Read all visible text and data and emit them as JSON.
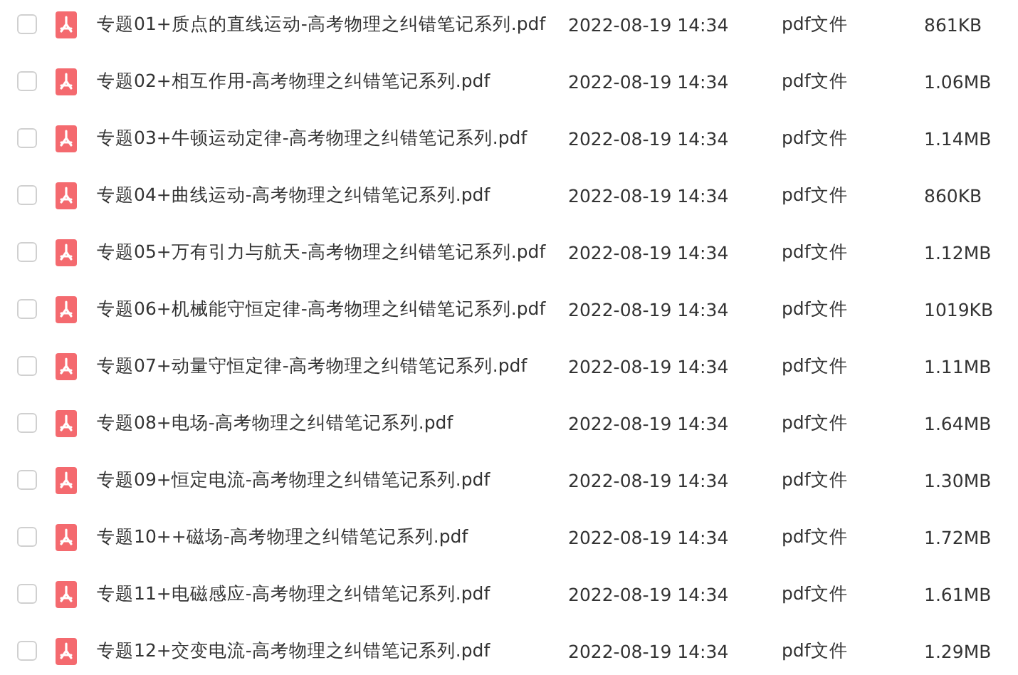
{
  "files": [
    {
      "name": "专题01+质点的直线运动-高考物理之纠错笔记系列.pdf",
      "date": "2022-08-19 14:34",
      "type": "pdf文件",
      "size": "861KB",
      "checked": false
    },
    {
      "name": "专题02+相互作用-高考物理之纠错笔记系列.pdf",
      "date": "2022-08-19 14:34",
      "type": "pdf文件",
      "size": "1.06MB",
      "checked": false
    },
    {
      "name": "专题03+牛顿运动定律-高考物理之纠错笔记系列.pdf",
      "date": "2022-08-19 14:34",
      "type": "pdf文件",
      "size": "1.14MB",
      "checked": false
    },
    {
      "name": "专题04+曲线运动-高考物理之纠错笔记系列.pdf",
      "date": "2022-08-19 14:34",
      "type": "pdf文件",
      "size": "860KB",
      "checked": false
    },
    {
      "name": "专题05+万有引力与航天-高考物理之纠错笔记系列.pdf",
      "date": "2022-08-19 14:34",
      "type": "pdf文件",
      "size": "1.12MB",
      "checked": false
    },
    {
      "name": "专题06+机械能守恒定律-高考物理之纠错笔记系列.pdf",
      "date": "2022-08-19 14:34",
      "type": "pdf文件",
      "size": "1019KB",
      "checked": false
    },
    {
      "name": "专题07+动量守恒定律-高考物理之纠错笔记系列.pdf",
      "date": "2022-08-19 14:34",
      "type": "pdf文件",
      "size": "1.11MB",
      "checked": false
    },
    {
      "name": "专题08+电场-高考物理之纠错笔记系列.pdf",
      "date": "2022-08-19 14:34",
      "type": "pdf文件",
      "size": "1.64MB",
      "checked": false
    },
    {
      "name": "专题09+恒定电流-高考物理之纠错笔记系列.pdf",
      "date": "2022-08-19 14:34",
      "type": "pdf文件",
      "size": "1.30MB",
      "checked": false
    },
    {
      "name": "专题10++磁场-高考物理之纠错笔记系列.pdf",
      "date": "2022-08-19 14:34",
      "type": "pdf文件",
      "size": "1.72MB",
      "checked": false
    },
    {
      "name": "专题11+电磁感应-高考物理之纠错笔记系列.pdf",
      "date": "2022-08-19 14:34",
      "type": "pdf文件",
      "size": "1.61MB",
      "checked": false
    },
    {
      "name": "专题12+交变电流-高考物理之纠错笔记系列.pdf",
      "date": "2022-08-19 14:34",
      "type": "pdf文件",
      "size": "1.29MB",
      "checked": false
    }
  ]
}
